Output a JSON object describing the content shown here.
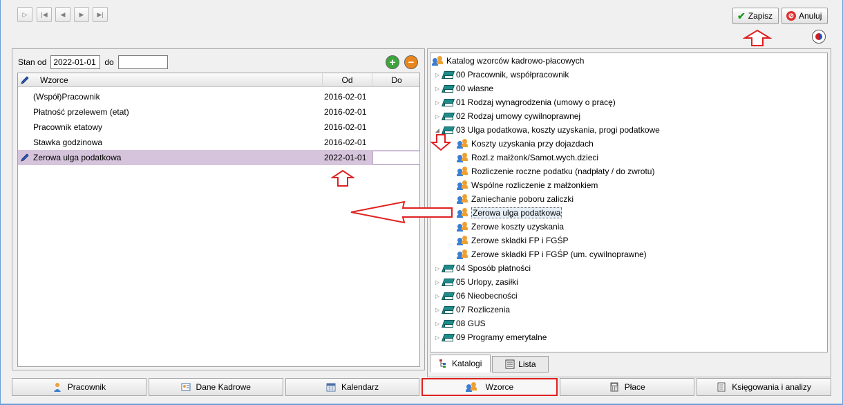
{
  "toolbar": {
    "nav_icons": [
      "play-icon",
      "first-record-icon",
      "prev-record-icon",
      "next-record-icon",
      "last-record-icon"
    ],
    "save_label": "Zapisz",
    "cancel_label": "Anuluj"
  },
  "filter": {
    "stan_od_label": "Stan od",
    "stan_od_value": "2022-01-01",
    "do_label": "do",
    "do_value": ""
  },
  "grid": {
    "headers": {
      "name": "Wzorce",
      "od": "Od",
      "do": "Do"
    },
    "rows": [
      {
        "name": "(Współ)Pracownik",
        "od": "2016-02-01",
        "do": ""
      },
      {
        "name": "Płatność przelewem (etat)",
        "od": "2016-02-01",
        "do": ""
      },
      {
        "name": "Pracownik etatowy",
        "od": "2016-02-01",
        "do": ""
      },
      {
        "name": "Stawka godzinowa",
        "od": "2016-02-01",
        "do": ""
      },
      {
        "name": "Zerowa ulga podatkowa",
        "od": "2022-01-01",
        "do": "",
        "selected": true
      }
    ]
  },
  "tree": {
    "root": "Katalog wzorców kadrowo-płacowych",
    "groups_top": [
      "00 Pracownik, współpracownik",
      "00 własne",
      "01 Rodzaj wynagrodzenia (umowy o pracę)",
      "02 Rodzaj umowy cywilnoprawnej",
      "03 Ulga podatkowa, koszty uzyskania, progi podatkowe"
    ],
    "children": [
      "Koszty uzyskania przy dojazdach",
      "Rozl.z małżonk/Samot.wych.dzieci",
      "Rozliczenie roczne podatku (nadpłaty / do zwrotu)",
      "Wspólne rozliczenie z małżonkiem",
      "Zaniechanie poboru zaliczki",
      "Zerowa ulga podatkowa",
      "Zerowe koszty uzyskania",
      "Zerowe składki FP i FGŚP",
      "Zerowe składki FP i FGŚP (um. cywilnoprawne)"
    ],
    "selected_child": "Zerowa ulga podatkowa",
    "groups_bottom": [
      "04 Sposób płatności",
      "05 Urlopy, zasiłki",
      "06 Nieobecności",
      "07 Rozliczenia",
      "08 GUS",
      "09 Programy emerytalne"
    ]
  },
  "tabs": {
    "catalog": "Katalogi",
    "list": "Lista"
  },
  "bottom_nav": [
    {
      "label": "Pracownik",
      "icon": "person-icon"
    },
    {
      "label": "Dane Kadrowe",
      "icon": "id-card-icon"
    },
    {
      "label": "Kalendarz",
      "icon": "calendar-icon"
    },
    {
      "label": "Wzorce",
      "icon": "people-icon",
      "highlighted": true
    },
    {
      "label": "Płace",
      "icon": "calculator-icon"
    },
    {
      "label": "Księgowania i analizy",
      "icon": "ledger-icon"
    }
  ],
  "colors": {
    "annotation": "#e02020",
    "selected_row": "#d5c4db",
    "accent": "#6a9ed6"
  }
}
